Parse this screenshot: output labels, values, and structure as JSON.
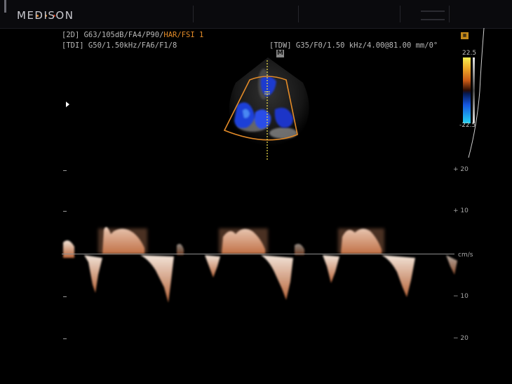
{
  "brand": {
    "name": "MEDISON",
    "dot_colors": [
      "#e3872c",
      "#e3872c",
      "#c83a1c"
    ]
  },
  "parameters": {
    "line1": {
      "prefix": "[2D] G63/105dB/FA4/P90/",
      "highlight": "HAR/FSI 1"
    },
    "line2": "[TDI] G50/1.50kHz/FA6/F1/8",
    "tdw": "[TDW] G35/F0/1.50 kHz/4.00@81.00 mm/0°",
    "m_marker": "M"
  },
  "color_scale": {
    "max": "22.5",
    "min": "-22.5"
  },
  "velocity_scale": {
    "unit": "cm/s",
    "labels": {
      "plus20": "+ 20",
      "plus10": "+ 10",
      "minus10": "− 10",
      "minus20": "− 20"
    }
  },
  "colors": {
    "accent": "#e38b28",
    "doppler": "#e8b49a",
    "flow_blue": "#1f3fd8"
  }
}
